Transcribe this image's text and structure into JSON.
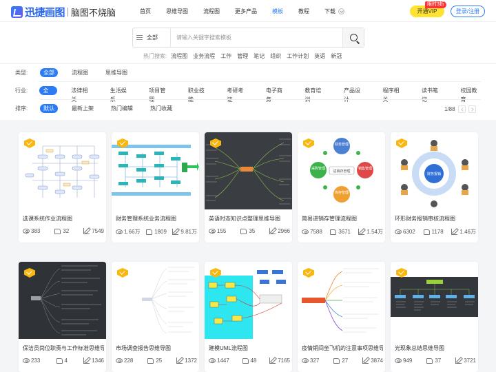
{
  "header": {
    "logo_name": "迅捷画图",
    "logo_slogan": "脑图不烧脑",
    "nav": [
      "首页",
      "思维导图",
      "流程图",
      "更多产品",
      "模板",
      "教程",
      "下载"
    ],
    "vip_label": "开通VIP",
    "vip_badge": "限时3折",
    "login_label": "登录/注册"
  },
  "search": {
    "category": "全部",
    "placeholder": "请输入关键字搜索模板",
    "hot_label": "热门搜索:",
    "hot": [
      "流程图",
      "业务流程",
      "工作",
      "管理",
      "笔记",
      "组织",
      "工作计划",
      "英语",
      "新冠"
    ]
  },
  "filters": {
    "type_label": "类型:",
    "types": [
      "全部",
      "流程图",
      "思维导图"
    ],
    "industry_label": "行业:",
    "industries": [
      "全部",
      "法律相关",
      "生活娱乐",
      "项目管理",
      "职业技能",
      "考研考证",
      "电子商务",
      "教育培训",
      "产品设计",
      "程序相关",
      "读书笔记",
      "校园教育"
    ],
    "sort_label": "排序:",
    "sorts": [
      "默认",
      "最新上架",
      "热门编辑",
      "热门收藏"
    ]
  },
  "pager": {
    "text": "1/88"
  },
  "colors": {
    "accent": "#2b7bf5",
    "vip": "#ffe234",
    "crown": "#f9b712"
  },
  "cards": [
    {
      "title": "选课系统作业流程图",
      "views": "383",
      "likes": "32",
      "edits": "7549"
    },
    {
      "title": "财务管理系统业务流程图",
      "views": "1.66万",
      "likes": "1809",
      "edits": "9.81万"
    },
    {
      "title": "英语时态知识点整理思维导图",
      "views": "155",
      "likes": "35",
      "edits": "2966"
    },
    {
      "title": "简易进销存管理流程图",
      "views": "7588",
      "likes": "3671",
      "edits": "1.54万"
    },
    {
      "title": "环形财务报销审核流程图",
      "views": "6302",
      "likes": "1178",
      "edits": "1.46万"
    },
    {
      "title": "保洁员岗位职责与工作标准思维导图",
      "views": "233",
      "likes": "4",
      "edits": "1346"
    },
    {
      "title": "市场调查报告思维导图",
      "views": "228",
      "likes": "25",
      "edits": "1372"
    },
    {
      "title": "建模UML流程图",
      "views": "1447",
      "likes": "48",
      "edits": "7165"
    },
    {
      "title": "疫情期间坐飞机的注意事项思维导图",
      "views": "327",
      "likes": "27",
      "edits": "3874"
    },
    {
      "title": "光现象总结思维导图",
      "views": "949",
      "likes": "37",
      "edits": "3721"
    }
  ],
  "thumbs": {
    "c4": {
      "center": "进销存管理",
      "nodes": [
        "财务管理",
        "销售管理",
        "库存管理",
        "采购管理"
      ]
    },
    "c5": {
      "center": "财务报销"
    }
  }
}
